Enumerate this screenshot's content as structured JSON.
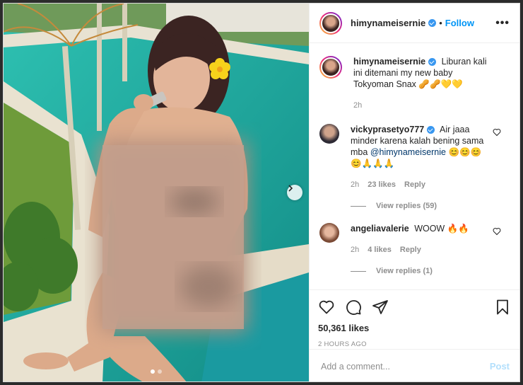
{
  "post": {
    "username": "himynameisernie",
    "follow_label": "Follow",
    "separator": "•",
    "more_label": "•••",
    "caption": "Liburan kali ini ditemani my new baby Tokyoman Snax",
    "caption_emoji": "🥜🥜💛💛",
    "caption_time": "2h",
    "likes": "50,361 likes",
    "timestamp": "2 HOURS AGO"
  },
  "comments": [
    {
      "username": "vickyprasetyo777",
      "text": "Air jaaa minder karena kalah bening sama mba",
      "mention": "@himynameisernie",
      "emoji": "😊😊😊😊🙏🙏🙏",
      "time": "2h",
      "likes": "23 likes",
      "reply_label": "Reply",
      "view_replies": "View replies (59)"
    },
    {
      "username": "angeliavalerie",
      "text": "WOOW",
      "emoji": "🔥🔥",
      "time": "2h",
      "likes": "4 likes",
      "reply_label": "Reply",
      "view_replies": "View replies (1)"
    }
  ],
  "composer": {
    "placeholder": "Add a comment...",
    "post_label": "Post"
  },
  "colors": {
    "accent": "#0095f6",
    "verified": "#3897f0",
    "muted": "#8e8e8e",
    "pool": "#1fa59a"
  },
  "icons": [
    "heart-icon",
    "comment-icon",
    "share-icon",
    "bookmark-icon",
    "next-arrow-icon",
    "verified-icon"
  ]
}
